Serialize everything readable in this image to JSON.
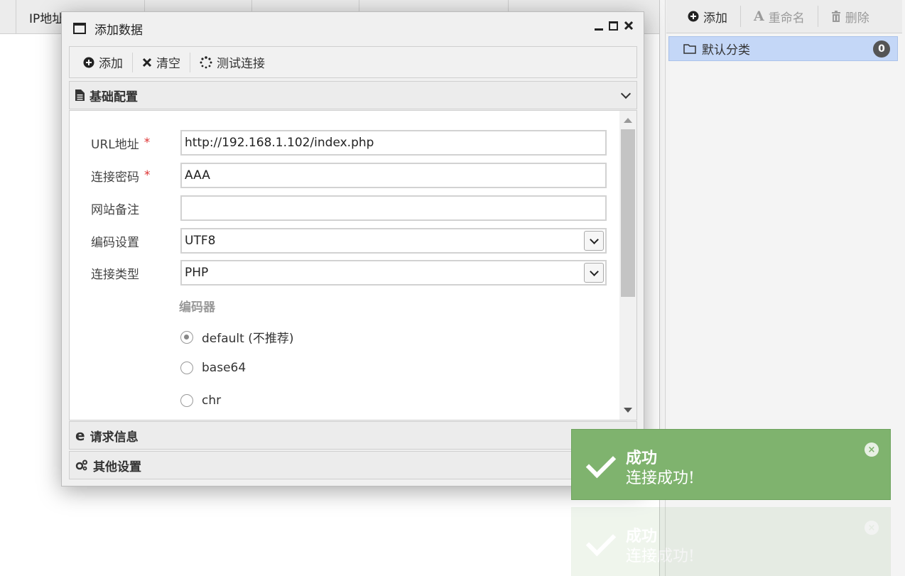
{
  "background_table": {
    "columns": [
      "IP地址",
      "",
      "",
      "",
      "",
      ""
    ]
  },
  "dialog": {
    "title": "添加数据",
    "toolbar": {
      "add_label": "添加",
      "clear_label": "清空",
      "test_label": "测试连接"
    },
    "sections": {
      "basic": "基础配置",
      "request": "请求信息",
      "other": "其他设置"
    },
    "form": {
      "url_label": "URL地址",
      "url_value": "http://192.168.1.102/index.php",
      "password_label": "连接密码",
      "password_value": "AAA",
      "note_label": "网站备注",
      "note_value": "",
      "encoding_label": "编码设置",
      "encoding_value": "UTF8",
      "type_label": "连接类型",
      "type_value": "PHP",
      "required_mark": "*",
      "encoder_section": "编码器",
      "encoders": [
        {
          "label": "default (不推荐)",
          "checked": true
        },
        {
          "label": "base64",
          "checked": false
        },
        {
          "label": "chr",
          "checked": false
        }
      ]
    }
  },
  "right_panel": {
    "toolbar": {
      "add_label": "添加",
      "rename_label": "重命名",
      "delete_label": "删除"
    },
    "category": {
      "label": "默认分类",
      "count": "0"
    }
  },
  "toast": {
    "title": "成功",
    "message": "连接成功!",
    "close": "×",
    "color": "#7fb36e"
  }
}
